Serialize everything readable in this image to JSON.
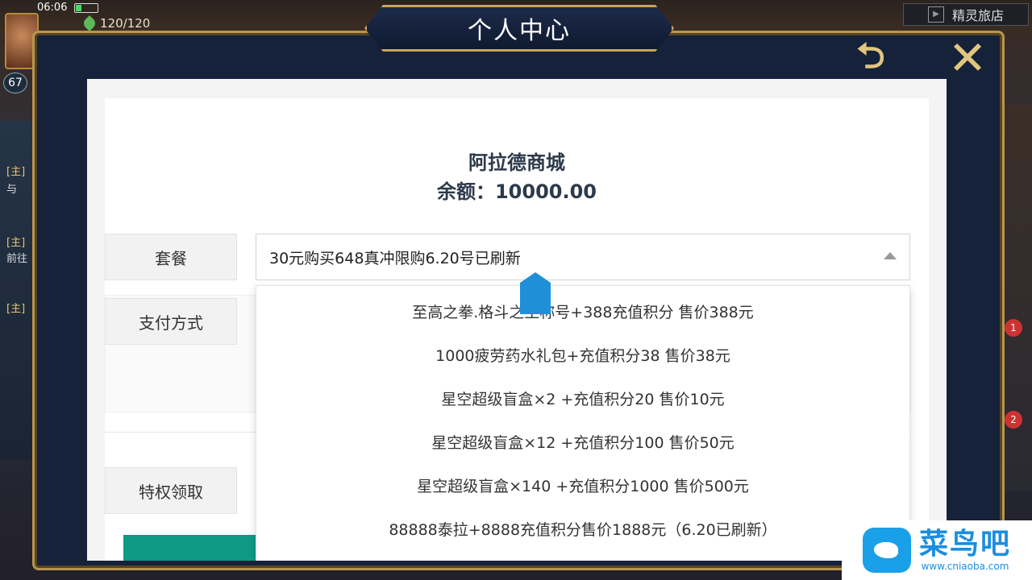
{
  "status_bar": {
    "time": "06:06",
    "stamina": "120/120"
  },
  "hud": {
    "level": "67",
    "side_tags": [
      "[主]",
      "与",
      "[主]",
      "前往",
      "[主]"
    ],
    "badges": [
      "1",
      "2"
    ],
    "inn_label": "精灵旅店"
  },
  "dialog": {
    "title": "个人中心",
    "back_icon": "back-arrow-icon",
    "close_icon": "close-icon"
  },
  "shop": {
    "name": "阿拉德商城",
    "balance": "余额：10000.00",
    "package_label": "套餐",
    "selected_package": "30元购买648真冲限购6.20号已刷新",
    "payment_label": "支付方式",
    "privilege_label": "特权领取",
    "options": [
      "至高之拳.格斗之王称号+388充值积分 售价388元",
      "1000疲劳药水礼包+充值积分38 售价38元",
      "星空超级盲盒×2 +充值积分20 售价10元",
      "星空超级盲盒×12 +充值积分100 售价50元",
      "星空超级盲盒×140 +充值积分1000 售价500元",
      "88888泰拉+8888充值积分售价1888元（6.20已刷新）"
    ]
  },
  "watermark": {
    "main": "菜鸟吧",
    "sub": "www.cniaoba.com"
  },
  "colors": {
    "frame_gold": "#b89550",
    "title_plate": "#1d2b4a",
    "accent_green": "#0f9a86",
    "marker_blue": "#1f8fd8"
  }
}
